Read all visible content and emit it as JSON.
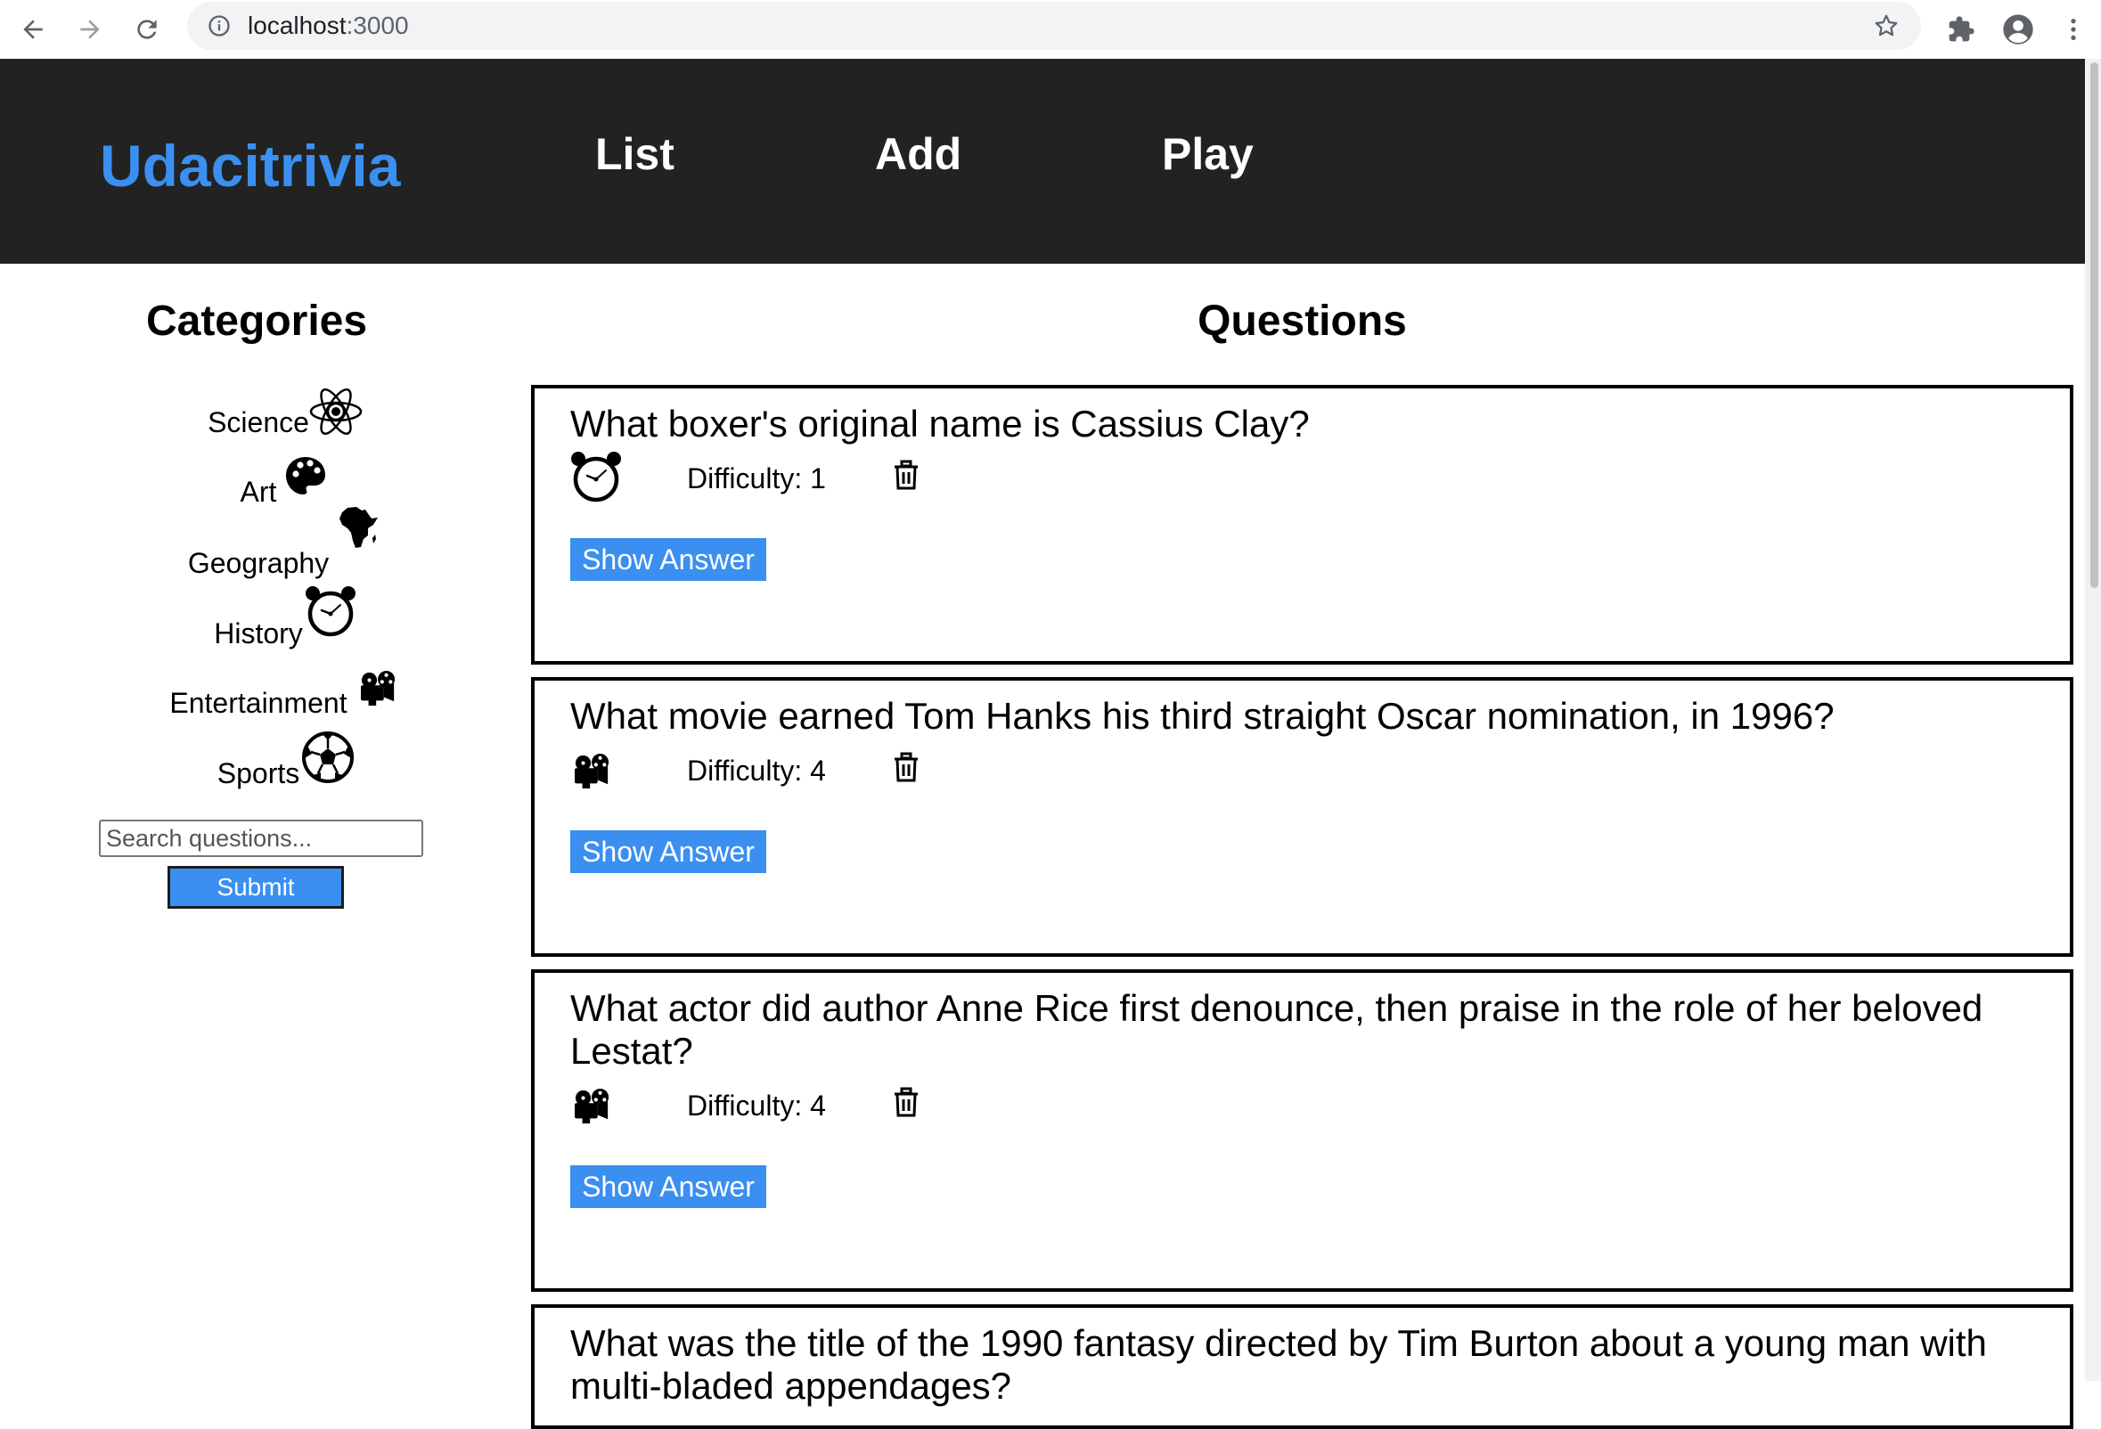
{
  "browser": {
    "url_host": "localhost",
    "url_port": ":3000"
  },
  "header": {
    "brand": "Udacitrivia",
    "nav": [
      "List",
      "Add",
      "Play"
    ]
  },
  "categories": {
    "title": "Categories",
    "items": [
      {
        "label": "Science",
        "icon": "atom-icon"
      },
      {
        "label": "Art",
        "icon": "palette-icon"
      },
      {
        "label": "Geography",
        "icon": "africa-map-icon"
      },
      {
        "label": "History",
        "icon": "alarm-clock-icon"
      },
      {
        "label": "Entertainment",
        "icon": "film-projector-icon"
      },
      {
        "label": "Sports",
        "icon": "soccer-ball-icon"
      }
    ]
  },
  "search": {
    "placeholder": "Search questions...",
    "submit_label": "Submit"
  },
  "questions": {
    "title": "Questions",
    "difficulty_prefix": "Difficulty:",
    "show_answer_label": "Show Answer",
    "items": [
      {
        "question": "What boxer's original name is Cassius Clay?",
        "difficulty": "1",
        "category_icon": "alarm-clock-icon"
      },
      {
        "question": "What movie earned Tom Hanks his third straight Oscar nomination, in 1996?",
        "difficulty": "4",
        "category_icon": "film-projector-icon"
      },
      {
        "question": "What actor did author Anne Rice first denounce, then praise in the role of her beloved Lestat?",
        "difficulty": "4",
        "category_icon": "film-projector-icon"
      },
      {
        "question": "What was the title of the 1990 fantasy directed by Tim Burton about a young man with multi-bladed appendages?"
      }
    ]
  },
  "colors": {
    "accent": "#3a8ff0",
    "header_bg": "#222222"
  }
}
